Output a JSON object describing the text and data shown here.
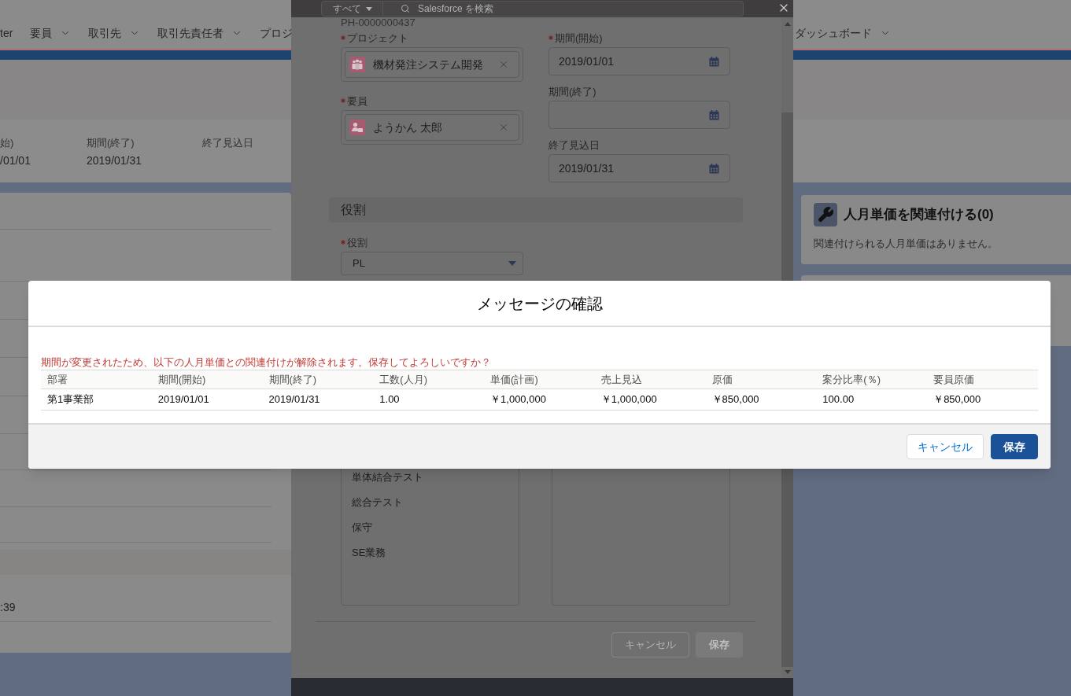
{
  "nav": {
    "items": [
      {
        "label": "ter",
        "has_menu": false
      },
      {
        "label": "要員",
        "has_menu": true
      },
      {
        "label": "取引先",
        "has_menu": true
      },
      {
        "label": "取引先責任者",
        "has_menu": true
      },
      {
        "label": "プロジ",
        "has_menu": false
      }
    ],
    "right_items": [
      {
        "label": "ダッシュボード",
        "has_menu": true
      }
    ]
  },
  "highlights": {
    "fields": [
      {
        "label": "始)",
        "value": "/01/01"
      },
      {
        "label": "期間(終了)",
        "value": "2019/01/31"
      },
      {
        "label": "終了見込日"
      }
    ]
  },
  "detail_card": {
    "field_value": ":39"
  },
  "related_cards": [
    {
      "title": "人月単価を関連付ける(0)",
      "message": "関連付けられる人月単価はありません。"
    }
  ],
  "form": {
    "search": {
      "scope": "すべて",
      "placeholder": "Salesforce を検索"
    },
    "record_number": "PH-0000000437",
    "lookups": [
      {
        "label": "プロジェクト",
        "required": true,
        "value": "機材発注システム開発",
        "kind": "project"
      },
      {
        "label": "要員",
        "required": true,
        "value": "ようかん 太郎",
        "kind": "person"
      }
    ],
    "dates": [
      {
        "label": "期間(開始)",
        "required": true,
        "value": "2019/01/01"
      },
      {
        "label": "期間(終了)",
        "required": false
      },
      {
        "label": "終了見込日",
        "required": false,
        "value": "2019/01/31"
      }
    ],
    "section": "役割",
    "role": {
      "label": "役割",
      "required": true,
      "value": "PL"
    },
    "options": [
      "単体結合テスト",
      "総合テスト",
      "保守",
      "SE業務"
    ],
    "buttons": [
      {
        "label": "キャンセル",
        "kind": "neutral",
        "disabled": true
      },
      {
        "label": "保存",
        "kind": "brand",
        "disabled": true
      }
    ]
  },
  "dialog": {
    "title": "メッセージの確認",
    "message": "期間が変更されたため、以下の人月単価との関連付けが解除されます。保存してよろしいですか？",
    "table": {
      "columns": [
        "部署",
        "期間(開始)",
        "期間(終了)",
        "工数(人月)",
        "単価(計画)",
        "売上見込",
        "原価",
        "案分比率(％)",
        "要員原価"
      ],
      "rows": [
        [
          "第1事業部",
          "2019/01/01",
          "2019/01/31",
          "1.00",
          "￥1,000,000",
          "￥1,000,000",
          "￥850,000",
          "100.00",
          "￥850,000"
        ]
      ]
    },
    "buttons": [
      {
        "label": "キャンセル",
        "kind": "neutral"
      },
      {
        "label": "保存",
        "kind": "brand"
      }
    ]
  }
}
